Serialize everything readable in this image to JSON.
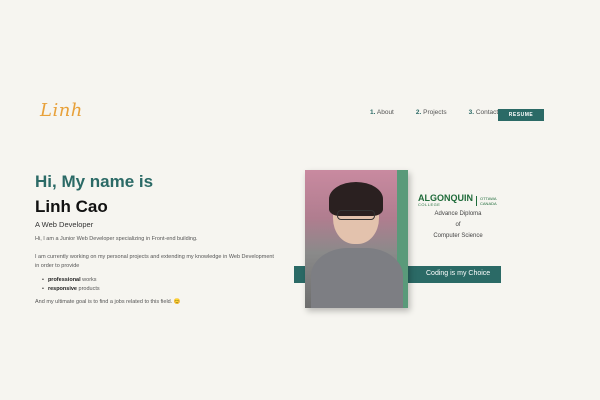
{
  "logo": "Linh",
  "nav": {
    "items": [
      {
        "num": "1.",
        "label": "About"
      },
      {
        "num": "2.",
        "label": "Projects"
      },
      {
        "num": "3.",
        "label": "Contacts"
      }
    ],
    "resume_label": "RESUME"
  },
  "hero": {
    "greeting": "Hi, My name is",
    "name": "Linh Cao",
    "role": "A Web Developer",
    "intro": "Hi, I am a Junior Web Developer specializing in Front-end building.",
    "paragraph": "I am currently working on my personal projects and extending my knowledge in Web Development in order to provide",
    "bullets": [
      {
        "strong": "professional",
        "rest": " works"
      },
      {
        "strong": "responsive",
        "rest": " products"
      }
    ],
    "goal": "And my ultimate goal is to find a jobs related to this field.",
    "goal_emoji": "😊"
  },
  "credential": {
    "college_name": "ALGONQUIN",
    "college_sub": "COLLEGE",
    "college_city_1": "OTTAWA",
    "college_city_2": "CANADA",
    "line1": "Advance Diploma",
    "line2": "of",
    "line3": "Computer Science",
    "banner": "Coding is my Choice"
  },
  "colors": {
    "accent": "#2b6a66",
    "logo": "#e8a13a",
    "background": "#f6f5f0"
  }
}
